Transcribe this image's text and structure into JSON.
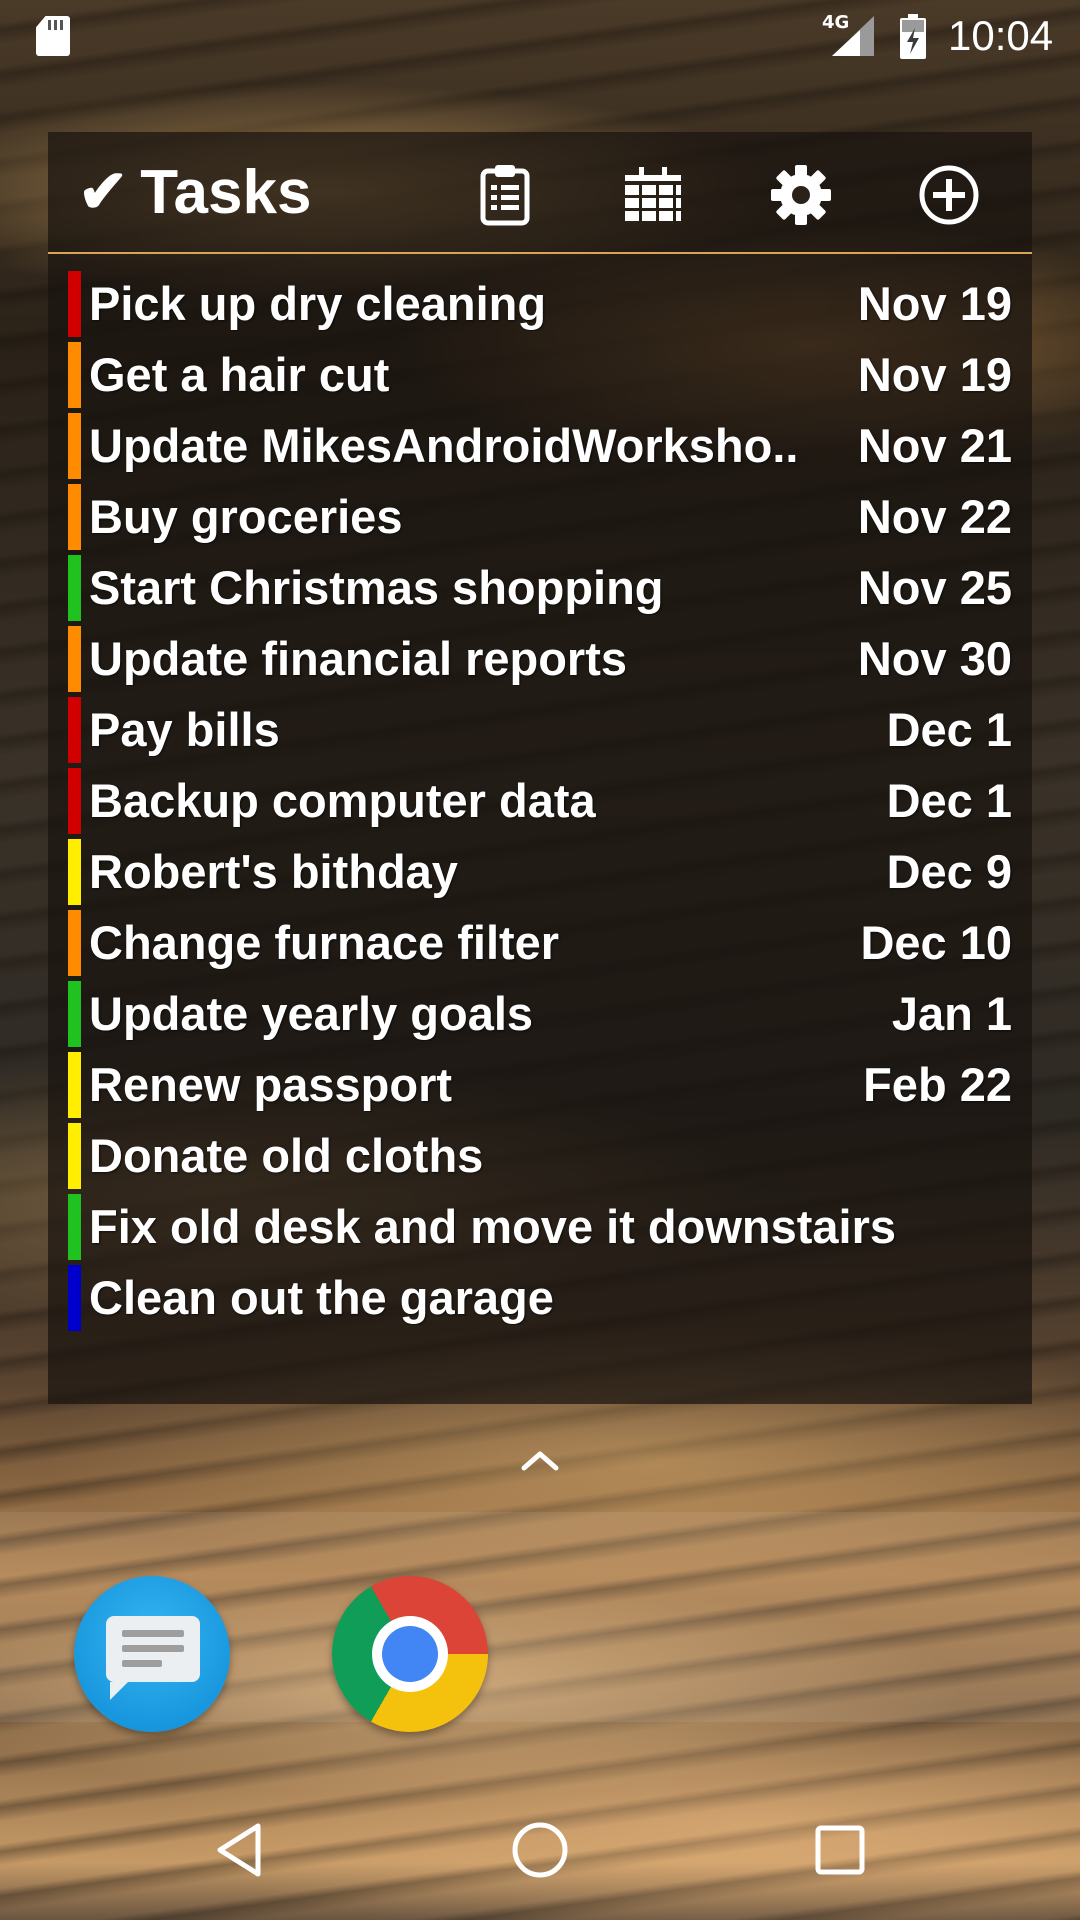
{
  "status_bar": {
    "network": "4G",
    "time": "10:04"
  },
  "widget": {
    "title": "Tasks",
    "check_glyph": "✔",
    "buttons": [
      {
        "name": "clipboard-icon"
      },
      {
        "name": "calendar-icon"
      },
      {
        "name": "gear-icon"
      },
      {
        "name": "add-circle-icon"
      }
    ],
    "tasks": [
      {
        "name": "Pick up dry cleaning",
        "date": "Nov 19",
        "color": "#d10000"
      },
      {
        "name": "Get a hair cut",
        "date": "Nov 19",
        "color": "#ff8c00"
      },
      {
        "name": "Update MikesAndroidWorksho..",
        "date": "Nov 21",
        "color": "#ff8c00"
      },
      {
        "name": "Buy groceries",
        "date": "Nov 22",
        "color": "#ff8c00"
      },
      {
        "name": "Start Christmas shopping",
        "date": "Nov 25",
        "color": "#1fc21f"
      },
      {
        "name": "Update financial reports",
        "date": "Nov 30",
        "color": "#ff8c00"
      },
      {
        "name": "Pay bills",
        "date": "Dec 1",
        "color": "#d10000"
      },
      {
        "name": "Backup computer data",
        "date": "Dec 1",
        "color": "#d10000"
      },
      {
        "name": "Robert's bithday",
        "date": "Dec 9",
        "color": "#ffee00"
      },
      {
        "name": "Change furnace filter",
        "date": "Dec 10",
        "color": "#ff8c00"
      },
      {
        "name": "Update yearly goals",
        "date": "Jan 1",
        "color": "#1fc21f"
      },
      {
        "name": "Renew passport",
        "date": "Feb 22",
        "color": "#ffee00"
      },
      {
        "name": "Donate old cloths",
        "date": "",
        "color": "#ffee00"
      },
      {
        "name": "Fix old desk and move it downstairs",
        "date": "",
        "color": "#1fc21f"
      },
      {
        "name": "Clean out the garage",
        "date": "",
        "color": "#0000cc"
      }
    ]
  },
  "dock": {
    "apps": [
      {
        "name": "messages-app-icon"
      },
      {
        "name": "chrome-app-icon"
      }
    ]
  },
  "nav": {
    "buttons": [
      "back-button",
      "home-button",
      "recents-button"
    ]
  }
}
